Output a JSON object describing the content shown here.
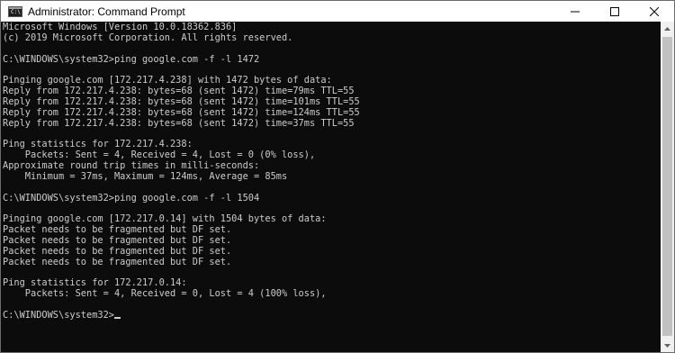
{
  "window": {
    "title": "Administrator: Command Prompt",
    "icon_label": "C:\\"
  },
  "controls": {
    "minimize_icon": "minimize-icon",
    "maximize_icon": "maximize-icon",
    "close_icon": "close-icon"
  },
  "console": {
    "lines": [
      "Microsoft Windows [Version 10.0.18362.836]",
      "(c) 2019 Microsoft Corporation. All rights reserved.",
      "",
      "C:\\WINDOWS\\system32>ping google.com -f -l 1472",
      "",
      "Pinging google.com [172.217.4.238] with 1472 bytes of data:",
      "Reply from 172.217.4.238: bytes=68 (sent 1472) time=79ms TTL=55",
      "Reply from 172.217.4.238: bytes=68 (sent 1472) time=101ms TTL=55",
      "Reply from 172.217.4.238: bytes=68 (sent 1472) time=124ms TTL=55",
      "Reply from 172.217.4.238: bytes=68 (sent 1472) time=37ms TTL=55",
      "",
      "Ping statistics for 172.217.4.238:",
      "    Packets: Sent = 4, Received = 4, Lost = 0 (0% loss),",
      "Approximate round trip times in milli-seconds:",
      "    Minimum = 37ms, Maximum = 124ms, Average = 85ms",
      "",
      "C:\\WINDOWS\\system32>ping google.com -f -l 1504",
      "",
      "Pinging google.com [172.217.0.14] with 1504 bytes of data:",
      "Packet needs to be fragmented but DF set.",
      "Packet needs to be fragmented but DF set.",
      "Packet needs to be fragmented but DF set.",
      "Packet needs to be fragmented but DF set.",
      "",
      "Ping statistics for 172.217.0.14:",
      "    Packets: Sent = 4, Received = 0, Lost = 4 (100% loss),",
      "",
      "C:\\WINDOWS\\system32>"
    ]
  },
  "colors": {
    "console_bg": "#0c0c0c",
    "console_text": "#cccccc",
    "titlebar_bg": "#ffffff"
  }
}
